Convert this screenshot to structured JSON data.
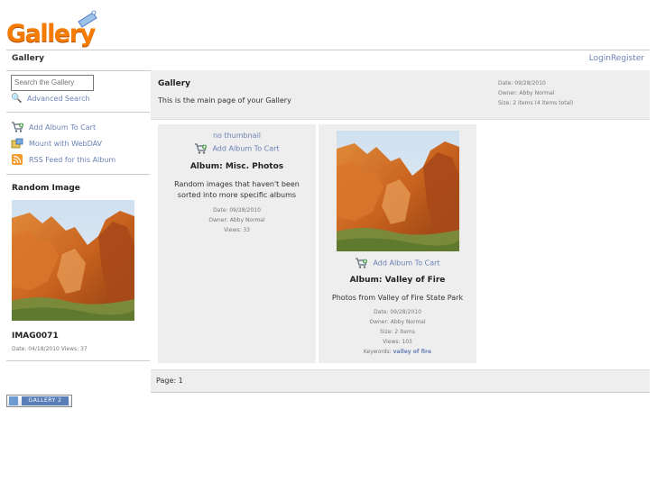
{
  "logo": {
    "text": "Gallery"
  },
  "header": {
    "breadcrumb": "Gallery",
    "login": "Login",
    "register": "Register"
  },
  "sidebar": {
    "search_placeholder": "Search the Gallery",
    "advanced_search": "Advanced Search",
    "actions": [
      {
        "label": "Add Album To Cart",
        "icon": "cart-icon"
      },
      {
        "label": "Mount with WebDAV",
        "icon": "webdav-icon"
      },
      {
        "label": "RSS Feed for this Album",
        "icon": "rss-icon"
      }
    ],
    "random_image": {
      "title": "Random Image",
      "name": "IMAG0071",
      "meta": "Date: 04/18/2010 Views: 37"
    }
  },
  "main": {
    "title": "Gallery",
    "description": "This is the main page of your Gallery",
    "meta": {
      "date": "Date: 09/28/2010",
      "owner": "Owner: Abby Normal",
      "size": "Size: 2 items (4 items total)"
    }
  },
  "albums": [
    {
      "thumbnail_text": "no thumbnail",
      "cart_label": "Add Album To Cart",
      "title": "Album: Misc. Photos",
      "description_line1": "Random images that haven't been",
      "description_line2": "sorted into more specific albums",
      "date": "Date: 09/28/2010",
      "owner": "Owner: Abby Normal",
      "views": "Views: 33"
    },
    {
      "cart_label": "Add Album To Cart",
      "title": "Album: Valley of Fire",
      "description": "Photos from Valley of Fire State Park",
      "date": "Date: 09/28/2010",
      "owner": "Owner: Abby Normal",
      "size": "Size: 2 items",
      "views": "Views: 103",
      "keywords_label": "Keywords:",
      "keywords_value": "valley of fire"
    }
  ],
  "footer": {
    "page": "Page:  1",
    "badge": "GALLERY 2"
  },
  "colors": {
    "link": "#6b82b6",
    "panel": "#eeeeee",
    "logo": "#f57c00"
  }
}
